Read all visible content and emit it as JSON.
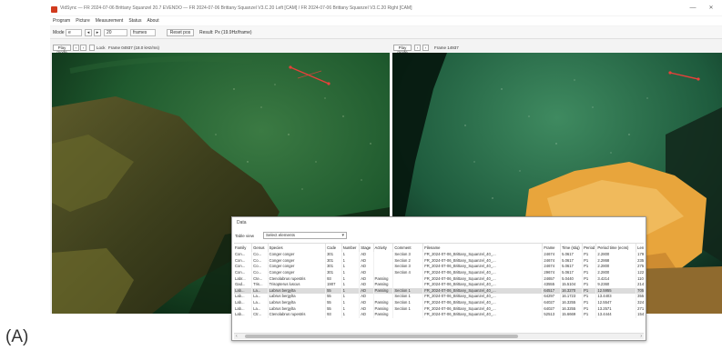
{
  "figure_label": "(A)",
  "window": {
    "title": "VidSync — FR 2024-07-06 Brittany Squanzel 20.7  EVENDO — FR 2024-07-06 Brittany Squanzel V3.C.20 Left [CAM] / FR 2024-07-06 Brittany Squanzel V3.C.20 Right [CAM]",
    "minimize_label": "—",
    "close_label": "✕"
  },
  "menu": [
    "Program",
    "Picture",
    "Measurement",
    "Status",
    "About"
  ],
  "toolbar": {
    "mode_label": "Mode",
    "mode_value": "e",
    "step_value": "20",
    "unit_value": "frames",
    "apply_label": "Reset pos",
    "speed_text": "Result: Px (19.9Hz/frame)"
  },
  "left_pane": {
    "play_label": "Play mode",
    "lock_label": "Lock",
    "frame_text": "Frame 04937 (18.0 kHz/ms)"
  },
  "right_pane": {
    "play_label": "Play mode",
    "frame_text": "Frame 14937"
  },
  "dialog": {
    "title": "Data",
    "view_label": "Table view",
    "view_value": "Select elements",
    "columns": [
      "Family",
      "Genus",
      "Species",
      "Code",
      "Number",
      "Stage",
      "Activity",
      "Comment",
      "Filename",
      "Frame",
      "Time (stiq)",
      "Period",
      "Period time (ecns)",
      "Length"
    ],
    "rows": [
      [
        "Con...",
        "Co...",
        "Conger conger",
        "301",
        "1",
        "AD",
        "",
        "Section 3",
        "FR_2024-07-06_Brittany_Squanzel_40_...",
        "24674",
        "5.0617",
        "P1",
        "2.2800",
        "179.7"
      ],
      [
        "Con...",
        "Co...",
        "Conger conger",
        "301",
        "1",
        "AD",
        "",
        "Section 2",
        "FR_2024-07-06_Brittany_Squanzel_40_...",
        "24674",
        "5.0617",
        "P1",
        "2.2868",
        "235.3"
      ],
      [
        "Con...",
        "Co...",
        "Conger conger",
        "301",
        "1",
        "AD",
        "",
        "Section 3",
        "FR_2024-07-06_Brittany_Squanzel_40_...",
        "24674",
        "5.0617",
        "P1",
        "2.2800",
        "275.1"
      ],
      [
        "Con...",
        "Co...",
        "Conger conger",
        "301",
        "1",
        "AD",
        "",
        "Section 4",
        "FR_2024-07-06_Brittany_Squanzel_40_...",
        "29674",
        "5.0617",
        "P1",
        "2.2800",
        "122.3"
      ],
      [
        "Labr...",
        "Cte...",
        "Ctenolabrus rupestris",
        "93",
        "1",
        "AD",
        "Passing",
        "",
        "FR_2024-07-06_Brittany_Squanzel_40_...",
        "24657",
        "5.0440",
        "P1",
        "3.4214",
        "110.4"
      ],
      [
        "Gad...",
        "Tris...",
        "Trisopterus luscus",
        "1907",
        "1",
        "AD",
        "Passing",
        "",
        "FR_2024-07-06_Brittany_Squanzel_40_...",
        "43555",
        "15.5104",
        "P1",
        "9.2360",
        "214.3"
      ],
      [
        "Lab...",
        "La...",
        "Labrus bergylta",
        "55",
        "1",
        "AD",
        "Passing",
        "Section 1",
        "FR_2024-07-06_Brittany_Squanzel_40_...",
        "64517",
        "16.3270",
        "P1",
        "12.5955",
        "705.3"
      ],
      [
        "Lab...",
        "La...",
        "Labrus bergylta",
        "55",
        "1",
        "AD",
        "",
        "Section 1",
        "FR_2024-07-06_Brittany_Squanzel_40_...",
        "64297",
        "16.1723",
        "P1",
        "13.4403",
        "355.4"
      ],
      [
        "Lab...",
        "La...",
        "Labrus bergylta",
        "55",
        "1",
        "AD",
        "Passing",
        "Section 1",
        "FR_2024-07-06_Brittany_Squanzel_40_...",
        "64027",
        "16.3255",
        "P1",
        "12.5547",
        "324.5"
      ],
      [
        "Lab...",
        "La...",
        "Labrus bergylta",
        "55",
        "1",
        "AD",
        "Passing",
        "Section 1",
        "FR_2024-07-06_Brittany_Squanzel_40_...",
        "64027",
        "16.3255",
        "P1",
        "13.2571",
        "271.1"
      ],
      [
        "Lab...",
        "Ctr...",
        "Ctenolabrus rupestris",
        "93",
        "1",
        "AD",
        "Passing",
        "",
        "FR_2024-07-06_Brittany_Squanzel_40_...",
        "52513",
        "15.6669",
        "P1",
        "13.4444",
        "154.1"
      ]
    ],
    "selected_row": 6,
    "scroll_left": "‹",
    "scroll_right": "›"
  },
  "colors": {
    "accent_red": "#e8403a",
    "selection_row": "#dcdcdc",
    "underwater_green": "#1f5a2e",
    "sponge_orange": "#e8a53c"
  }
}
